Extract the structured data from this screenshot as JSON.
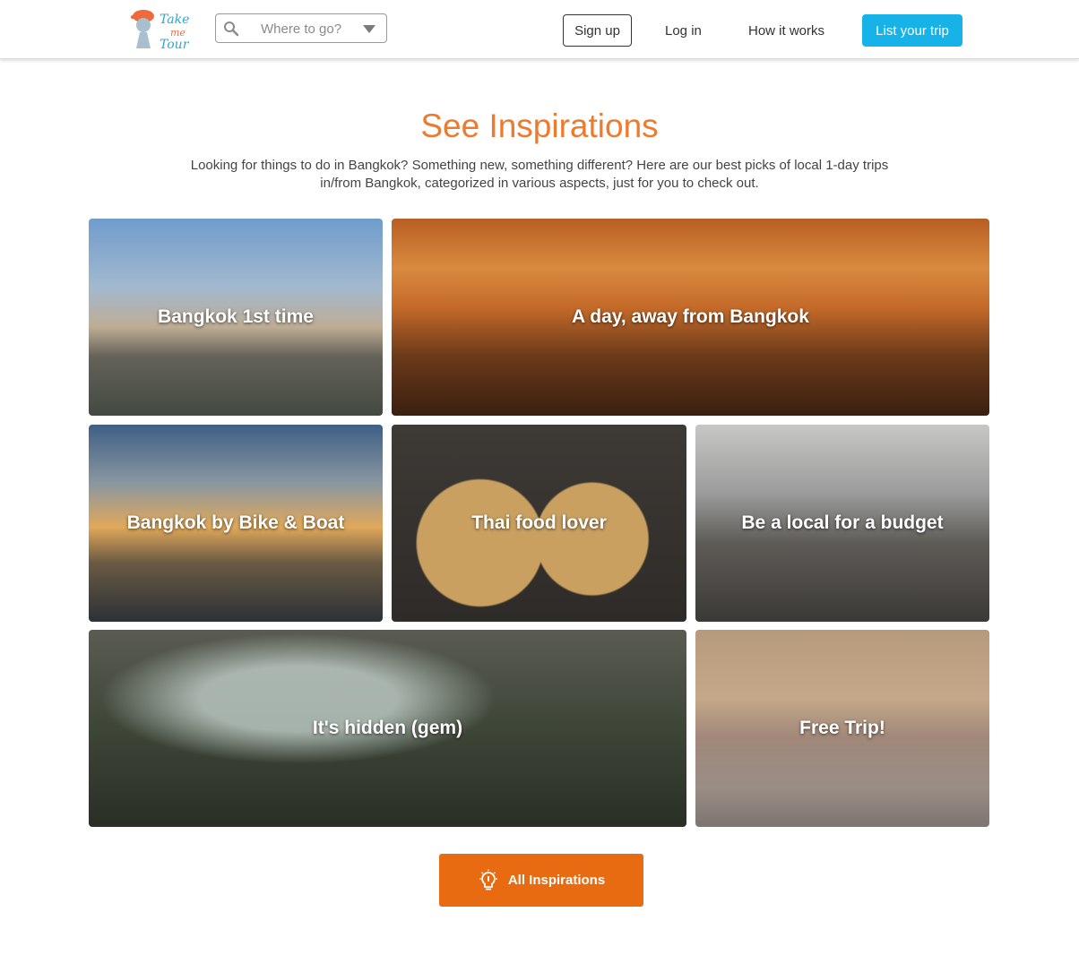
{
  "header": {
    "logo_text": [
      "Take",
      "me",
      "Tour"
    ],
    "search": {
      "placeholder": "Where to go?",
      "icon": "search-icon"
    },
    "nav": {
      "signup_label": "Sign up",
      "login_label": "Log in",
      "how_label": "How it works",
      "list_label": "List your trip"
    }
  },
  "main": {
    "title": "See Inspirations",
    "subtitle": "Looking for things to do in Bangkok? Something new, something different? Here are our best picks of local 1-day trips in/from Bangkok, categorized in various aspects, just for you to check out.",
    "tiles": [
      {
        "label": "Bangkok 1st time"
      },
      {
        "label": "A day, away from Bangkok"
      },
      {
        "label": "Bangkok by Bike & Boat"
      },
      {
        "label": "Thai food lover"
      },
      {
        "label": "Be a local for a budget"
      },
      {
        "label": "It's hidden (gem)"
      },
      {
        "label": "Free Trip!"
      }
    ],
    "all_button_label": "All Inspirations",
    "all_button_icon": "lightbulb-icon"
  },
  "colors": {
    "accent_orange": "#e86b12",
    "title_orange": "#ec7a2f",
    "primary_blue": "#17b2e8"
  }
}
